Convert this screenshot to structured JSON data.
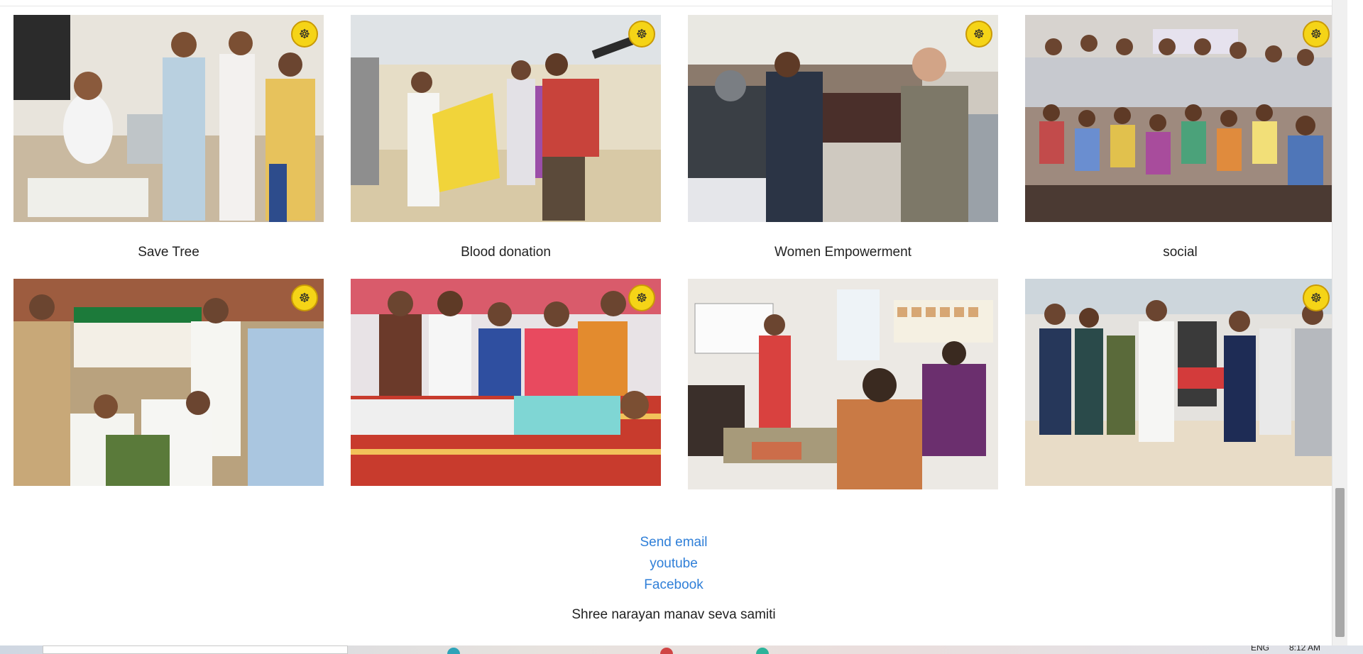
{
  "gallery": {
    "row1": [
      {
        "scene": "medical-camp",
        "logo": "samiti-logo-icon"
      },
      {
        "scene": "road-rally",
        "logo": "samiti-logo-icon"
      },
      {
        "scene": "blanket-distribution",
        "logo": "samiti-logo-icon"
      },
      {
        "scene": "children-group",
        "logo": "samiti-logo-icon"
      }
    ],
    "row2": [
      {
        "caption": "Save Tree",
        "scene": "tree-plantation",
        "logo": "samiti-logo-icon"
      },
      {
        "caption": "Blood donation",
        "scene": "blood-donation",
        "logo": "samiti-logo-icon"
      },
      {
        "caption": "Women Empowerment",
        "scene": "sewing-class"
      },
      {
        "caption": "social",
        "scene": "water-cooler-inauguration",
        "logo": "samiti-logo-icon"
      }
    ]
  },
  "footer": {
    "links": [
      "Send email",
      "youtube",
      "Facebook"
    ],
    "org_name": "Shree narayan manav seva samiti"
  },
  "taskbar": {
    "tray_lang": "ENG",
    "tray_time": "8:12 AM"
  },
  "colors": {
    "link": "#2f7fd8",
    "text": "#222222",
    "logo_yellow": "#f5d417"
  }
}
